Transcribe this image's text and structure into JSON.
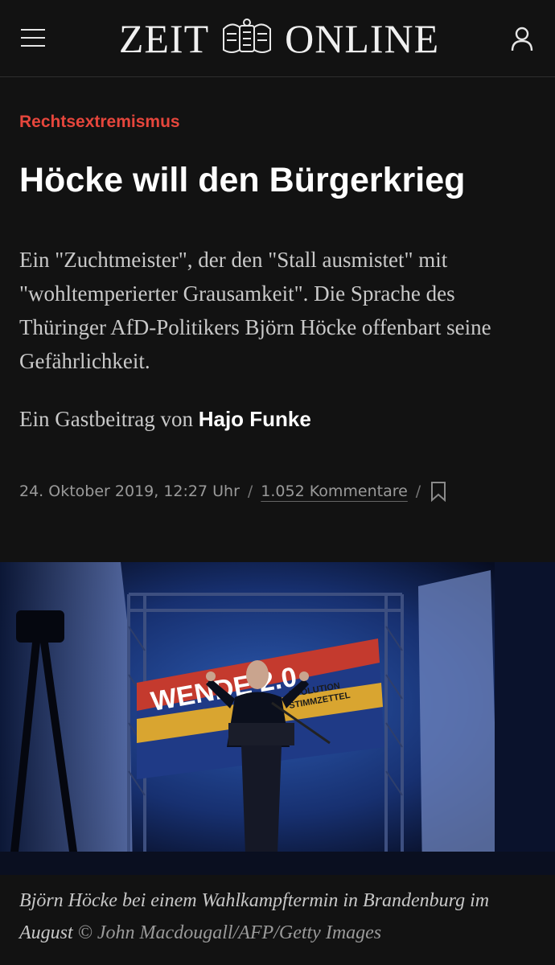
{
  "header": {
    "logo_left": "ZEIT",
    "logo_right": "ONLINE",
    "menu_icon": "hamburger-menu-icon",
    "user_icon": "user-icon"
  },
  "article": {
    "category": "Rechtsextremismus",
    "headline": "Höcke will den Bürgerkrieg",
    "lead": "Ein \"Zuchtmeister\", der den \"Stall ausmistet\" mit \"wohltemperierter Grausamkeit\". Die Sprache des Thüringer AfD-Politikers Björn Höcke offenbart seine Gefährlichkeit.",
    "byline_prefix": "Ein Gastbeitrag von",
    "author": "Hajo Funke",
    "date": "24. Oktober 2019, 12:27 Uhr",
    "separator": "/",
    "comments": "1.052 Kommentare",
    "bookmark_icon": "bookmark-icon"
  },
  "photo": {
    "banner_text": "WENDE 2.0",
    "banner_sub_1": "EVOLUTION",
    "banner_sub_2": "STIMMZETTEL",
    "caption": "Björn Höcke bei einem Wahlkampftermin in Brandenburg im August",
    "credit": "© John Macdougall/AFP/Getty Images"
  },
  "colors": {
    "background": "#121212",
    "category": "#e6463c",
    "text": "#ffffff"
  }
}
